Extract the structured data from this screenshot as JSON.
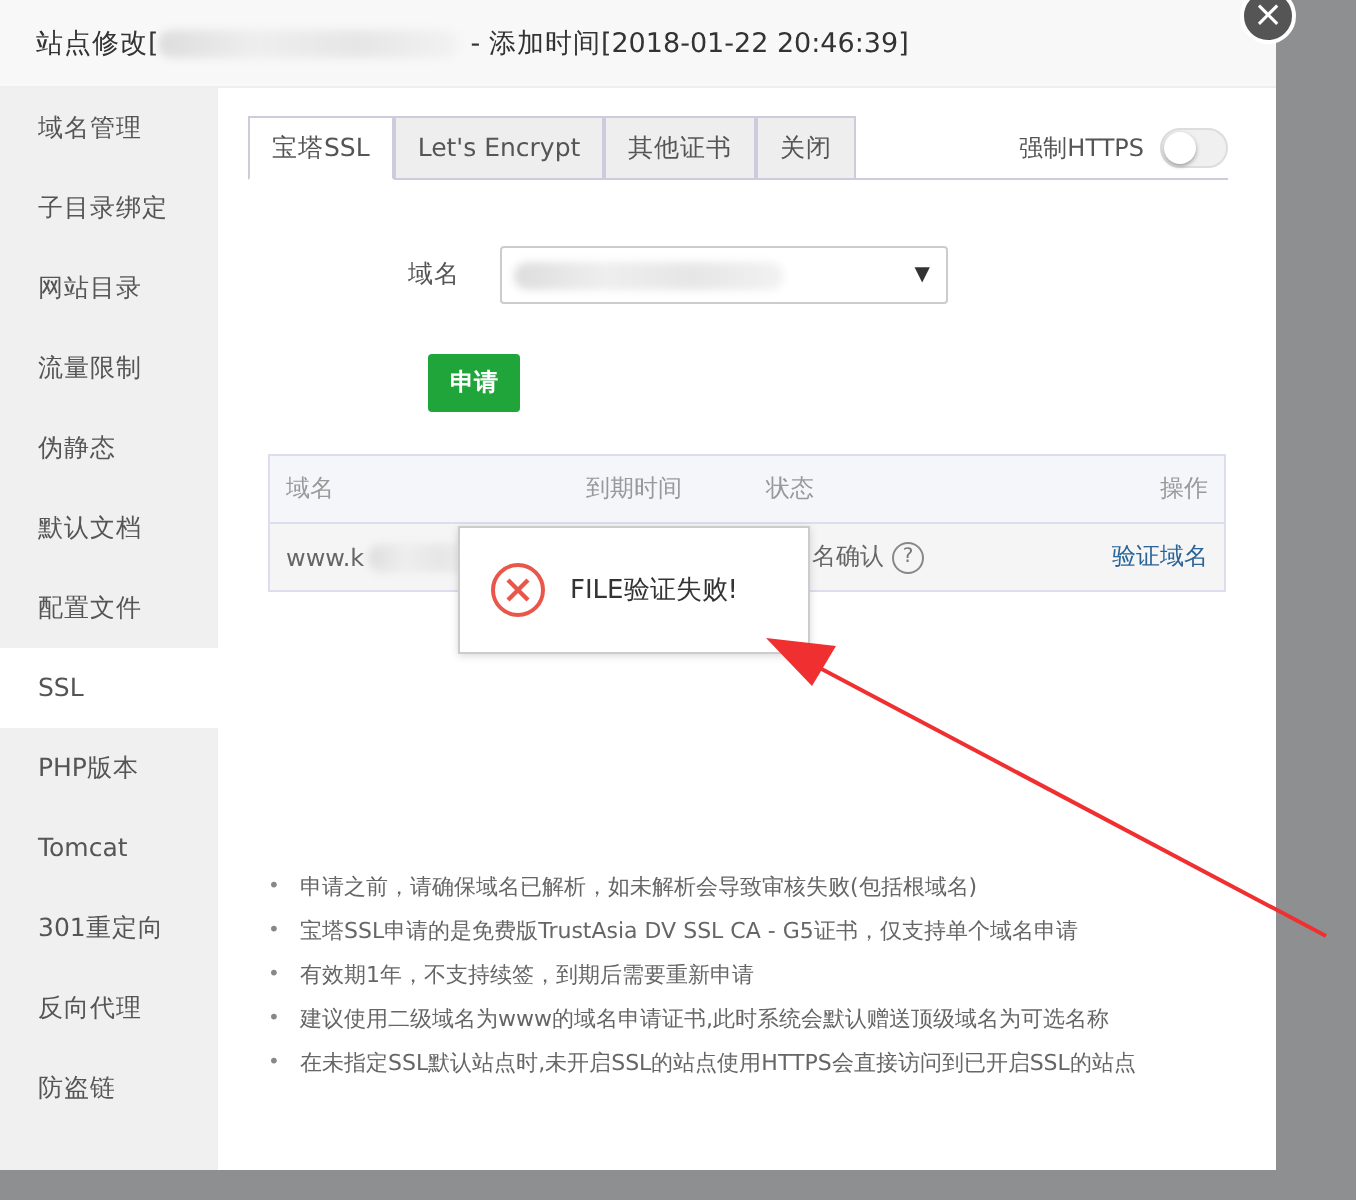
{
  "window": {
    "title_start": "站点修改[",
    "title_end": "- 添加时间[2018-01-22 20:46:39]",
    "close": "×"
  },
  "sidebar": {
    "items": [
      {
        "label": "域名管理",
        "selected": false
      },
      {
        "label": "子目录绑定",
        "selected": false
      },
      {
        "label": "网站目录",
        "selected": false
      },
      {
        "label": "流量限制",
        "selected": false
      },
      {
        "label": "伪静态",
        "selected": false
      },
      {
        "label": "默认文档",
        "selected": false
      },
      {
        "label": "配置文件",
        "selected": false
      },
      {
        "label": "SSL",
        "selected": true
      },
      {
        "label": "PHP版本",
        "selected": false
      },
      {
        "label": "Tomcat",
        "selected": false
      },
      {
        "label": "301重定向",
        "selected": false
      },
      {
        "label": "反向代理",
        "selected": false
      },
      {
        "label": "防盗链",
        "selected": false
      }
    ]
  },
  "tabs": [
    {
      "label": "宝塔SSL",
      "selected": true
    },
    {
      "label": "Let's Encrypt",
      "selected": false
    },
    {
      "label": "其他证书",
      "selected": false
    },
    {
      "label": "关闭",
      "selected": false
    }
  ],
  "force_https": {
    "label": "强制HTTPS",
    "on": false
  },
  "domain_field": {
    "label": "域名",
    "caret": "▼"
  },
  "apply_button": "申请",
  "table": {
    "columns": [
      "域名",
      "到期时间",
      "状态",
      "操作"
    ],
    "rows": [
      {
        "domain": "www.k",
        "status": "名确认",
        "help": "?",
        "action": "验证域名"
      }
    ]
  },
  "popup": {
    "message": "FILE验证失败!"
  },
  "bullet": "•",
  "notes": [
    "申请之前，请确保域名已解析，如未解析会导致审核失败(包括根域名)",
    "宝塔SSL申请的是免费版TrustAsia DV SSL CA - G5证书，仅支持单个域名申请",
    "有效期1年，不支持续签，到期后需要重新申请",
    "建议使用二级域名为www的域名申请证书,此时系统会默认赠送顶级域名为可选名称",
    "在未指定SSL默认站点时,未开启SSL的站点使用HTTPS会直接访问到已开启SSL的站点"
  ]
}
